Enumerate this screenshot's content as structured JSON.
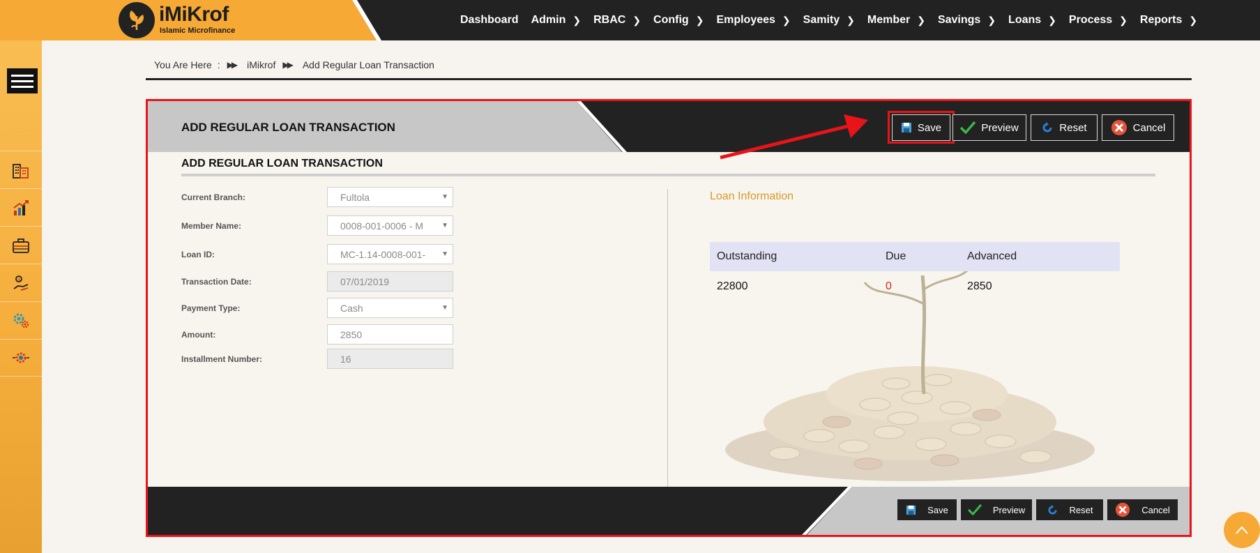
{
  "brand": {
    "name": "iMiKrof",
    "tagline": "Islamic Microfinance"
  },
  "nav": [
    {
      "label": "Dashboard",
      "has_sub": false
    },
    {
      "label": "Admin",
      "has_sub": true
    },
    {
      "label": "RBAC",
      "has_sub": true
    },
    {
      "label": "Config",
      "has_sub": true
    },
    {
      "label": "Employees",
      "has_sub": true
    },
    {
      "label": "Samity",
      "has_sub": true
    },
    {
      "label": "Member",
      "has_sub": true
    },
    {
      "label": "Savings",
      "has_sub": true
    },
    {
      "label": "Loans",
      "has_sub": true
    },
    {
      "label": "Process",
      "has_sub": true
    },
    {
      "label": "Reports",
      "has_sub": true
    }
  ],
  "breadcrumb": {
    "prefix": "You Are Here",
    "colon": ":",
    "home": "iMikrof",
    "current": "Add Regular Loan Transaction"
  },
  "panel": {
    "header_title": "ADD REGULAR LOAN TRANSACTION",
    "section_title": "ADD REGULAR LOAN TRANSACTION"
  },
  "buttons": {
    "save": "Save",
    "preview": "Preview",
    "reset": "Reset",
    "cancel": "Cancel"
  },
  "form": {
    "current_branch": {
      "label": "Current Branch:",
      "value": "Fultola"
    },
    "member_name": {
      "label": "Member Name:",
      "value": "0008-001-0006 - M"
    },
    "loan_id": {
      "label": "Loan ID:",
      "value": "MC-1.14-0008-001-"
    },
    "transaction_date": {
      "label": "Transaction Date:",
      "value": "07/01/2019"
    },
    "payment_type": {
      "label": "Payment Type:",
      "value": "Cash"
    },
    "amount": {
      "label": "Amount:",
      "value": "2850"
    },
    "installment_number": {
      "label": "Installment Number:",
      "value": "16"
    }
  },
  "loan_info": {
    "title": "Loan Information",
    "headers": {
      "outstanding": "Outstanding",
      "due": "Due",
      "advanced": "Advanced"
    },
    "values": {
      "outstanding": "22800",
      "due": "0",
      "advanced": "2850"
    }
  },
  "sidebar_icons": [
    "building-icon",
    "growth-chart-icon",
    "briefcase-icon",
    "hand-money-icon",
    "gears-icon",
    "settings-icon"
  ],
  "colors": {
    "brand_orange": "#f6a935",
    "dark": "#222222",
    "highlight_red": "#e8141a",
    "accent_gold": "#d59a2a"
  }
}
